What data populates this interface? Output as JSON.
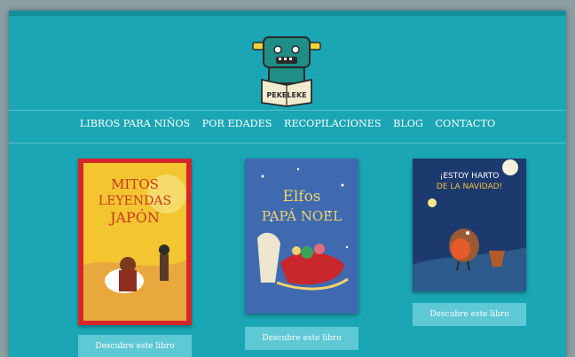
{
  "site": {
    "logo_text": "PEKELEKE"
  },
  "nav": {
    "items": [
      "LIBROS PARA NIÑOS",
      "POR EDADES",
      "RECOPILACIONES",
      "BLOG",
      "CONTACTO"
    ]
  },
  "books": [
    {
      "cover_title": "MITOS Y LEYENDAS DE JAPÓN",
      "cta": "Descubre este libro"
    },
    {
      "cover_title": "LOS ELFOS DE PAPÁ NOEL",
      "cta": "Descubre este libro"
    },
    {
      "cover_title": "¡ESTOY HARTO DE LA NAVIDAD!",
      "cta": "Descubre este libro"
    }
  ],
  "colors": {
    "background": "#1aa6b4",
    "button": "#5ec8d5",
    "text": "#ffffff"
  }
}
